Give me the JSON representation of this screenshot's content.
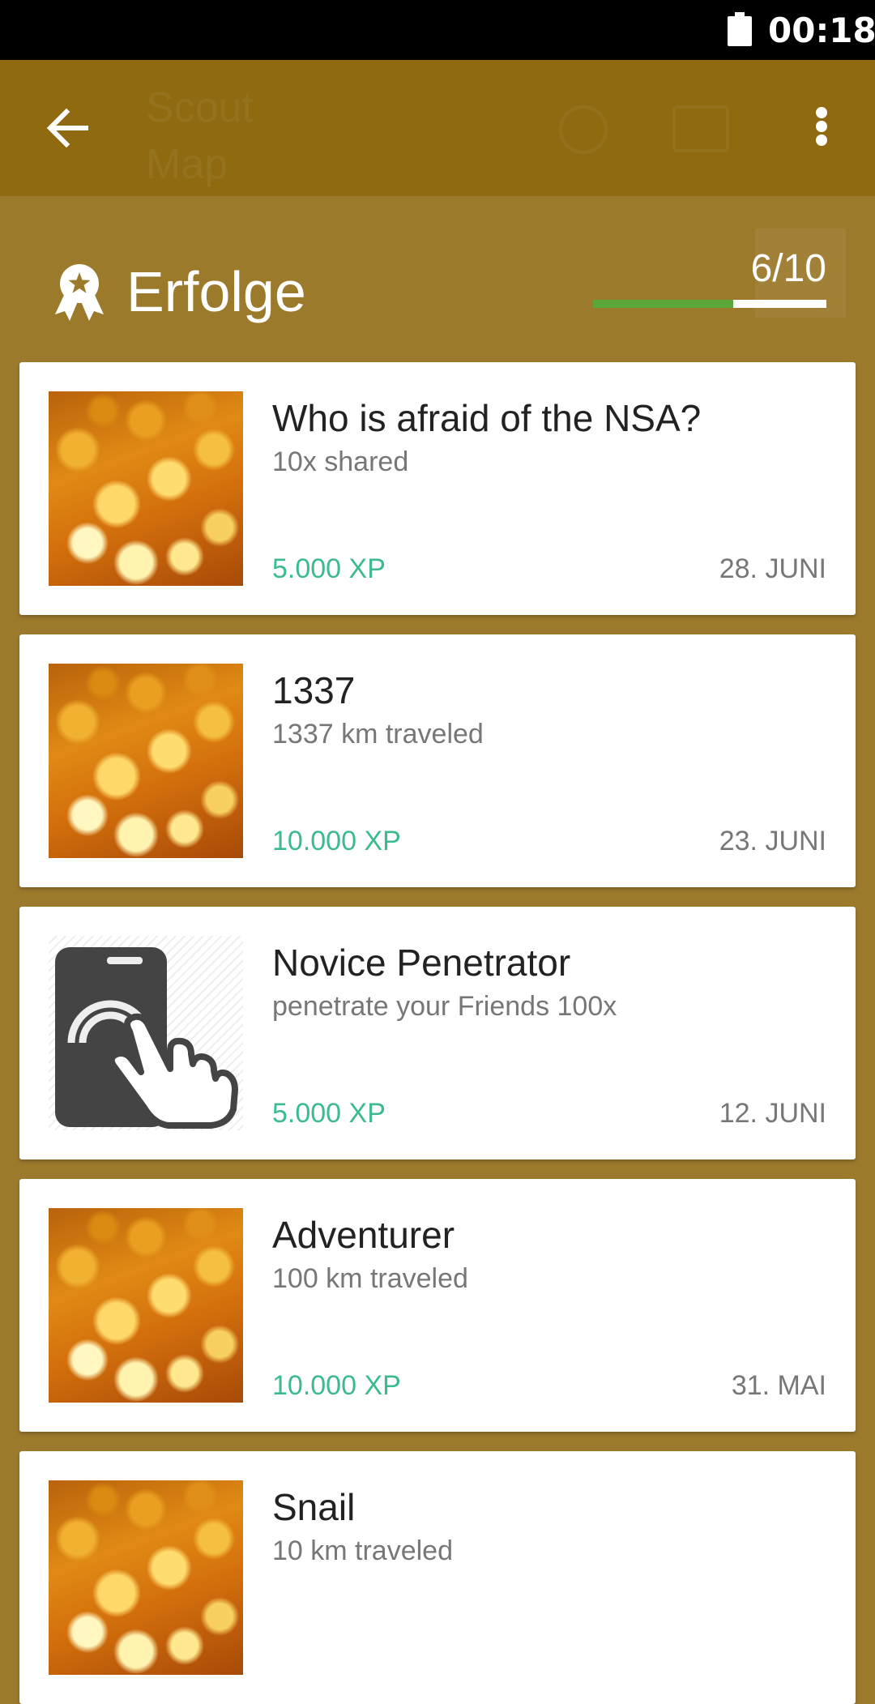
{
  "status_bar": {
    "time": "00:18"
  },
  "app_bar": {
    "ghost_title": "Scout Map"
  },
  "section": {
    "title": "Erfolge",
    "progress_text": "6/10",
    "progress_fraction": 0.6
  },
  "colors": {
    "background": "#9c7a2c",
    "app_bar": "#8f6a10",
    "xp_text": "#3dbb8f",
    "progress_fill": "#5aa83a"
  },
  "achievements": [
    {
      "title": "Who is afraid of the NSA?",
      "subtitle": "10x shared",
      "xp": "5.000 XP",
      "date": "28. JUNI",
      "image": "bokeh-image"
    },
    {
      "title": "1337",
      "subtitle": "1337 km traveled",
      "xp": "10.000 XP",
      "date": "23. JUNI",
      "image": "bokeh-image"
    },
    {
      "title": "Novice Penetrator",
      "subtitle": "penetrate your Friends 100x",
      "xp": "5.000 XP",
      "date": "12. JUNI",
      "image": "touch-phone-icon"
    },
    {
      "title": "Adventurer",
      "subtitle": "100 km traveled",
      "xp": "10.000 XP",
      "date": "31. MAI",
      "image": "bokeh-image"
    },
    {
      "title": "Snail",
      "subtitle": "10 km traveled",
      "xp": "",
      "date": "",
      "image": "bokeh-image"
    }
  ]
}
